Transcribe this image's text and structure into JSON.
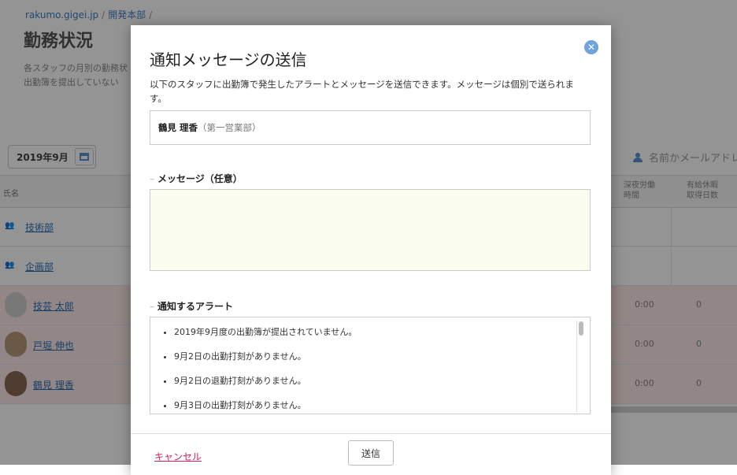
{
  "breadcrumb": {
    "org": "rakumo.gigei.jp",
    "dept": "開発本部"
  },
  "page": {
    "title": "勤務状況",
    "desc_line1": "各スタッフの月別の勤務状",
    "desc_line2": "出勤簿を提出していない"
  },
  "month_picker": {
    "value": "2019年9月",
    "icon": "calendar-icon"
  },
  "search": {
    "placeholder": "名前かメールアドレ"
  },
  "table": {
    "col_name": "氏名",
    "col_night": [
      "深夜労働",
      "時間"
    ],
    "col_paid": [
      "有給休暇",
      "取得日数"
    ],
    "rows": [
      {
        "name": "技術部",
        "type": "group",
        "night": "",
        "paid": ""
      },
      {
        "name": "企画部",
        "type": "group",
        "night": "",
        "paid": ""
      },
      {
        "name": "技芸 太郎",
        "type": "person",
        "night": "0:00",
        "paid": "0"
      },
      {
        "name": "戸堀 伸也",
        "type": "person",
        "night": "0:00",
        "paid": "0"
      },
      {
        "name": "鶴見 理香",
        "type": "person",
        "night": "0:00",
        "paid": "0"
      }
    ]
  },
  "modal": {
    "title": "通知メッセージの送信",
    "desc": "以下のスタッフに出勤簿で発生したアラートとメッセージを送信できます。メッセージは個別で送られます。",
    "staff_name": "鶴見 理香",
    "staff_dept": "（第一営業部）",
    "message_label": "メッセージ（任意）",
    "message_value": "",
    "alerts_label": "通知するアラート",
    "alerts": [
      "2019年9月度の出勤簿が提出されていません。",
      "9月2日の出勤打刻がありません。",
      "9月2日の退勤打刻がありません。",
      "9月3日の出勤打刻がありません。"
    ],
    "cancel_label": "キャンセル",
    "send_label": "送信",
    "close_icon": "close-icon"
  },
  "colors": {
    "accent": "#2a6fb8",
    "danger": "#d0205a",
    "alert_row": "#fbe9e7",
    "message_bg": "#fbfdf0"
  }
}
